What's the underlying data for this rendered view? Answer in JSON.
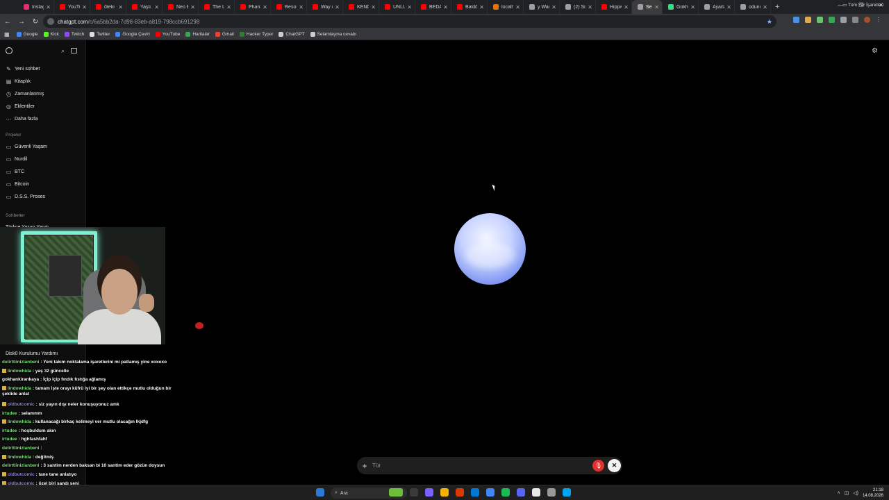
{
  "browser": {
    "tabs": [
      {
        "title": "Instagr",
        "color": "#e1306c"
      },
      {
        "title": "YouTub",
        "color": "#ff0000"
      },
      {
        "title": "öteki -",
        "color": "#ff0000"
      },
      {
        "title": "Yaşlı Al",
        "color": "#ff0000"
      },
      {
        "title": "Neo Bi",
        "color": "#ff0000"
      },
      {
        "title": "The Lo",
        "color": "#ff0000"
      },
      {
        "title": "Phantc",
        "color": "#ff0000"
      },
      {
        "title": "Resona",
        "color": "#ff0000"
      },
      {
        "title": "Way of",
        "color": "#ff0000"
      },
      {
        "title": "KENDİ",
        "color": "#ff0000"
      },
      {
        "title": "ÜNLÜ",
        "color": "#ff0000"
      },
      {
        "title": "BEDAV",
        "color": "#ff0000"
      },
      {
        "title": "Baldö",
        "color": "#ff0000"
      },
      {
        "title": "localh",
        "color": "#e8710a"
      },
      {
        "title": "y Warı",
        "color": "#9aa0a6"
      },
      {
        "title": "(2) Sin",
        "color": "#9aa0a6"
      },
      {
        "title": "HippiC",
        "color": "#ff0000"
      },
      {
        "title": "Sel",
        "color": "#9aa0a6",
        "active": true
      },
      {
        "title": "Gokha",
        "color": "#3ddc84"
      },
      {
        "title": "Ayarla",
        "color": "#9aa0a6"
      },
      {
        "title": "oduno",
        "color": "#9aa0a6"
      }
    ],
    "url_host": "chatgpt.com",
    "url_path": "/c/6a5bb2da-7d98-83eb-a819-798ccb691298",
    "bookmarks": [
      {
        "label": "Google",
        "color": "#4285f4"
      },
      {
        "label": "Kick",
        "color": "#53fc18"
      },
      {
        "label": "Twitch",
        "color": "#9146ff"
      },
      {
        "label": "Twitter",
        "color": "#dddddd"
      },
      {
        "label": "Google Çeviri",
        "color": "#4285f4"
      },
      {
        "label": "YouTube",
        "color": "#ff0000"
      },
      {
        "label": "Haritalar",
        "color": "#34a853"
      },
      {
        "label": "Gmail",
        "color": "#ea4335"
      },
      {
        "label": "Hacker Typer",
        "color": "#2e7d32"
      },
      {
        "label": "ChatGPT",
        "color": "#cccccc"
      },
      {
        "label": "Selamlaşma cevabı",
        "color": "#cccccc"
      }
    ],
    "all_bookmarks": "Tüm Yer İşaretleri"
  },
  "sidebar": {
    "items": [
      {
        "label": "Yeni sohbet",
        "icon": "✎"
      },
      {
        "label": "Kitaplık",
        "icon": "▤"
      },
      {
        "label": "Zamanlanmış",
        "icon": "◷"
      },
      {
        "label": "Eklentiler",
        "icon": "◎"
      },
      {
        "label": "Daha fazla",
        "icon": "⋯"
      }
    ],
    "projects_heading": "Projeler",
    "projects": [
      "Güvenli Yaşam",
      "Nurdil",
      "BTC",
      "Bitcoin",
      "D.S.S. Proses"
    ],
    "chats_heading": "Sohbetler",
    "chats_visible": [
      "Türkçe Yazım Yanıtı",
      "Disk0 Kurulumu Yardımı"
    ]
  },
  "composer": {
    "placeholder": "Tür"
  },
  "stream_chat": [
    {
      "user": "delirttiinizlanbeni",
      "color": "#7ae07a",
      "text": ": Yeni takım noktalama işaretlerini mi patlamış yine xoxoxo"
    },
    {
      "user": "lindowhida",
      "color": "#7ae07a",
      "text": ": yaş 32 güncelle",
      "badge": true
    },
    {
      "user": "gokhankirankaya",
      "color": "#ffffff",
      "text": ": İçip içip fındık fıstığa ağlamış"
    },
    {
      "user": "lindowhida",
      "color": "#7ae07a",
      "text": ": tamam işte orayı küfrü iyi bir şey olan ettikçe mutlu olduğun bir şeklide anlat",
      "badge": true
    },
    {
      "user": "oldbutcomic",
      "color": "#9a7cff",
      "text": ": siz yayın dışı neler konuşuyonuz amk",
      "badge": true
    },
    {
      "user": "irtudee",
      "color": "#7ae07a",
      "text": ": selammm"
    },
    {
      "user": "lindowhida",
      "color": "#7ae07a",
      "text": ": kullanacağı birkaç kelimeyi ver mutlu olacağın lkjdfg",
      "badge": true
    },
    {
      "user": "irtudee",
      "color": "#7ae07a",
      "text": ": hoşbuldum akın"
    },
    {
      "user": "irtudee",
      "color": "#7ae07a",
      "text": ": hghfashfahf"
    },
    {
      "user": "delirttiinizlanbeni",
      "color": "#7ae07a",
      "text": ":"
    },
    {
      "user": "lindowhida",
      "color": "#7ae07a",
      "text": ": değilmiş",
      "badge": true
    },
    {
      "user": "delirttiinizlanbeni",
      "color": "#7ae07a",
      "text": ": 3 santim nerden baksan bi 10 santim eder gözün doysun"
    },
    {
      "user": "oldbutcomic",
      "color": "#9a7cff",
      "text": ": tane tane anlatıyo",
      "badge": true
    },
    {
      "user": "oldbutcomic",
      "color": "#9a7cff",
      "text": ": özel biri sandı seni",
      "badge": true
    }
  ],
  "taskbar": {
    "search_placeholder": "Ara",
    "time": "21:18",
    "date": "14.08.2026",
    "icons": [
      "#6bbd3a",
      "#3a3a3a",
      "#7b61ff",
      "#f4b400",
      "#d83b01",
      "#0078d4",
      "#4285f4",
      "#1db954",
      "#5865f2",
      "#e8e8e8",
      "#999999",
      "#00a4ef"
    ]
  }
}
